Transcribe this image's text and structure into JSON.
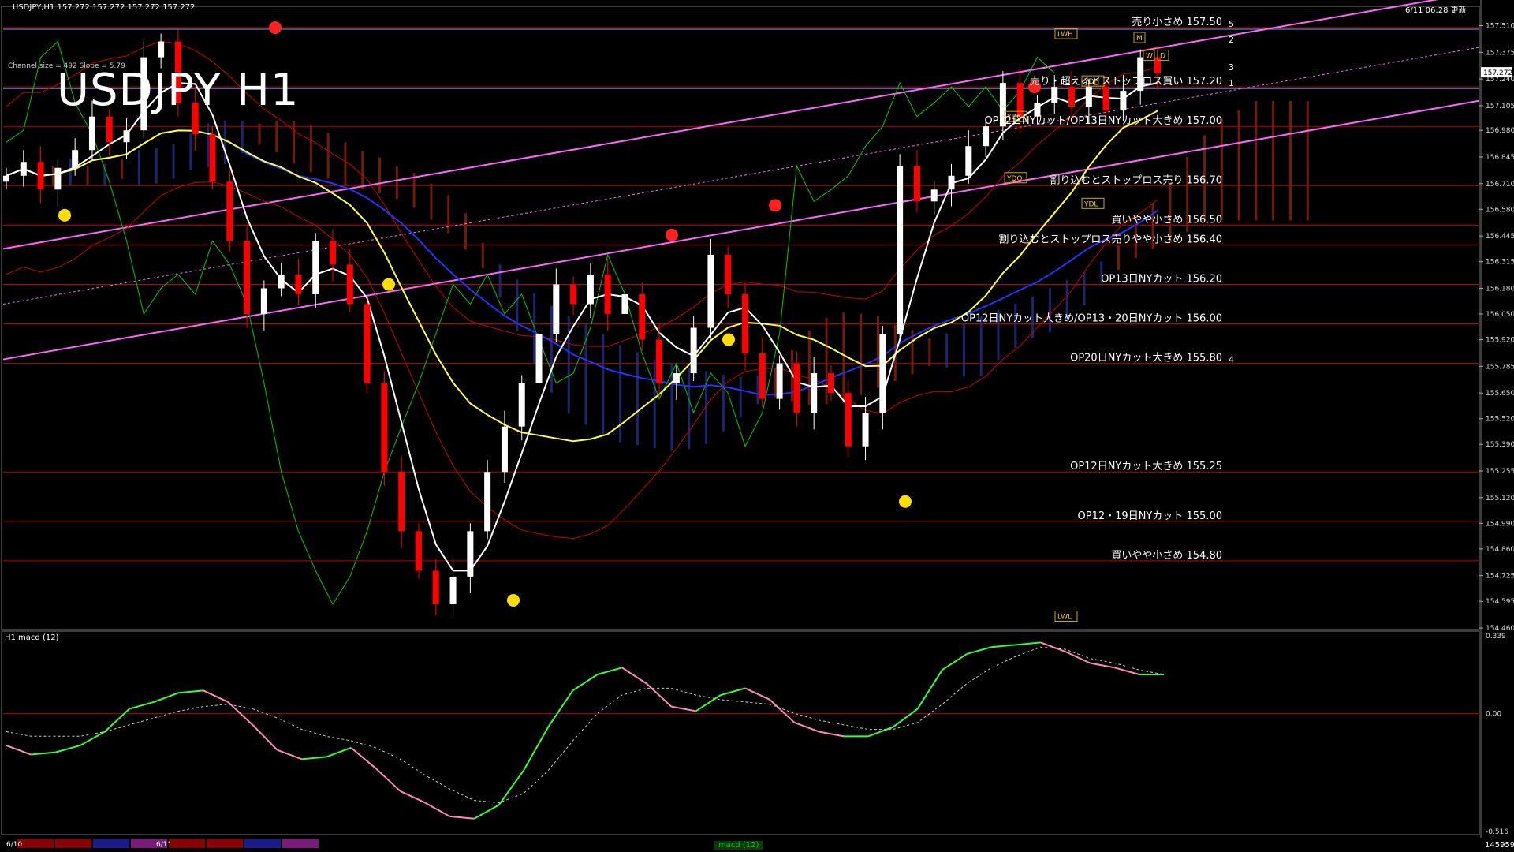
{
  "header": {
    "info": "USDJPY,H1  157.272 157.272 157.272 157.272",
    "channel": "Channel size = 492 Slope = 5.79",
    "time": "6/11 06:28 更新",
    "title": "USDJPY H1",
    "indicator_label": "H1  macd (12)",
    "macd_tab": "macd (12)",
    "volume": "145959"
  },
  "colors": {
    "background": "#000000",
    "level_line": "#c00000",
    "channel": "#ff66ff",
    "ma_white": "#ffffff",
    "ma_yellow": "#ffff33",
    "ma_blue": "#2233ff",
    "bollinger": "#cc0000",
    "chikou": "#00cc00",
    "candle_up": "#ffffff",
    "candle_down": "#ff0000",
    "macd_up": "#33ff33",
    "macd_down": "#ff88bb"
  },
  "chart_data": [
    {
      "type": "candlestick",
      "title": "USDJPY H1",
      "ylim": [
        154.46,
        157.6
      ],
      "yticks": [
        "157.510",
        "157.375",
        "157.240",
        "157.105",
        "156.980",
        "156.845",
        "156.710",
        "156.580",
        "156.445",
        "156.315",
        "156.180",
        "156.050",
        "155.920",
        "155.785",
        "155.650",
        "155.520",
        "155.390",
        "155.255",
        "155.120",
        "154.990",
        "154.860",
        "154.725",
        "154.595",
        "154.460"
      ],
      "current_price": "157.272",
      "x_date_labels": [
        "6/10",
        "6/11"
      ],
      "close_path": [
        156.75,
        156.82,
        156.68,
        156.79,
        156.88,
        157.05,
        156.92,
        156.98,
        157.35,
        157.43,
        157.12,
        156.96,
        156.72,
        156.42,
        156.05,
        156.18,
        156.25,
        156.15,
        156.42,
        156.3,
        156.1,
        155.7,
        155.25,
        154.95,
        154.75,
        154.58,
        154.72,
        154.95,
        155.25,
        155.48,
        155.7,
        155.95,
        156.2,
        156.1,
        156.25,
        156.05,
        156.15,
        155.92,
        155.7,
        155.75,
        155.98,
        156.35,
        156.15,
        155.85,
        155.62,
        155.8,
        155.55,
        155.75,
        155.65,
        155.38,
        155.55,
        155.95,
        156.8,
        156.62,
        156.68,
        156.75,
        156.9,
        157.0,
        157.22,
        157.05,
        157.12,
        157.2,
        157.1,
        157.2,
        157.08,
        157.18,
        157.35,
        157.27
      ],
      "levels": [
        {
          "price": 157.5,
          "label": "売り小さめ 157.50",
          "num": "5"
        },
        {
          "price": 157.2,
          "label": "売り・超えるとストップロス買い 157.20",
          "num": "1"
        },
        {
          "price": 157.0,
          "label": "OP12日NYカット/OP13日NYカット大きめ 157.00"
        },
        {
          "price": 156.7,
          "label": "割り込むとストップロス売り 156.70"
        },
        {
          "price": 156.5,
          "label": "買いやや小さめ 156.50"
        },
        {
          "price": 156.4,
          "label": "割り込むとストップロス売りやや小さめ 156.40"
        },
        {
          "price": 156.2,
          "label": "OP13日NYカット 156.20"
        },
        {
          "price": 156.0,
          "label": "OP12日NYカット大きめ/OP13・20日NYカット 156.00"
        },
        {
          "price": 155.8,
          "label": "OP20日NYカット大きめ 155.80",
          "num": "4"
        },
        {
          "price": 155.25,
          "label": "OP12日NYカット大きめ 155.25"
        },
        {
          "price": 155.0,
          "label": "OP12・19日NYカット 155.00"
        },
        {
          "price": 154.8,
          "label": "買いやや小さめ 154.80"
        }
      ],
      "channel_numbers": [
        "5",
        "2",
        "3",
        "1",
        "4"
      ],
      "markers": [
        "LWH",
        "YDH",
        "YDC",
        "YDO",
        "YDL",
        "LWL",
        "M",
        "W",
        "D"
      ]
    },
    {
      "type": "line",
      "title": "H1  macd (12)",
      "ylim": [
        -0.516,
        0.339
      ],
      "yticks": [
        "0.339",
        "0.00",
        "-0.516"
      ],
      "series": [
        {
          "values": [
            -0.14,
            -0.18,
            -0.17,
            -0.14,
            -0.08,
            0.02,
            0.05,
            0.09,
            0.1,
            0.05,
            -0.05,
            -0.16,
            -0.2,
            -0.19,
            -0.15,
            -0.24,
            -0.34,
            -0.39,
            -0.45,
            -0.46,
            -0.4,
            -0.25,
            -0.06,
            0.1,
            0.17,
            0.2,
            0.13,
            0.03,
            0.01,
            0.08,
            0.11,
            0.06,
            -0.04,
            -0.08,
            -0.1,
            -0.1,
            -0.06,
            0.02,
            0.19,
            0.26,
            0.29,
            0.3,
            0.31,
            0.27,
            0.22,
            0.2,
            0.17,
            0.17
          ]
        },
        {
          "values": [
            -0.08,
            -0.1,
            -0.1,
            -0.1,
            -0.08,
            -0.05,
            -0.02,
            0.01,
            0.03,
            0.04,
            0.02,
            -0.02,
            -0.07,
            -0.1,
            -0.12,
            -0.15,
            -0.2,
            -0.27,
            -0.33,
            -0.38,
            -0.39,
            -0.35,
            -0.25,
            -0.12,
            0.0,
            0.08,
            0.11,
            0.11,
            0.08,
            0.06,
            0.05,
            0.04,
            0.0,
            -0.03,
            -0.05,
            -0.07,
            -0.07,
            -0.04,
            0.04,
            0.13,
            0.2,
            0.25,
            0.29,
            0.28,
            0.24,
            0.22,
            0.19,
            0.17
          ]
        }
      ]
    }
  ]
}
